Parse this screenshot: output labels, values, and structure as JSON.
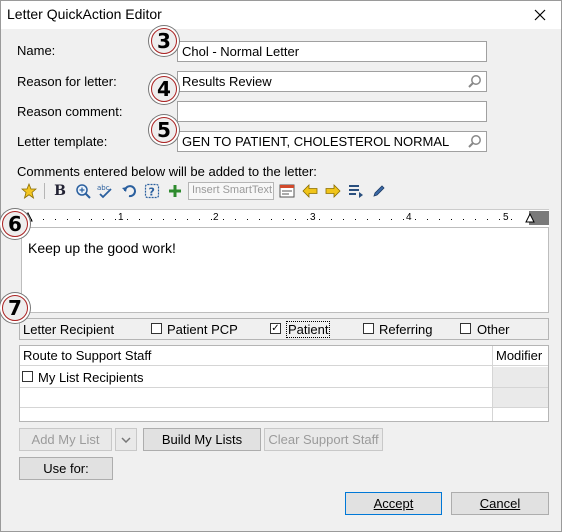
{
  "window": {
    "title": "Letter QuickAction Editor"
  },
  "badges": {
    "b3": "3",
    "b4": "4",
    "b5": "5",
    "b6": "6",
    "b7": "7"
  },
  "form": {
    "name_label": "Name:",
    "name_value": "Chol - Normal Letter",
    "reason_label": "Reason for letter:",
    "reason_value": "Results Review",
    "reason_comment_label": "Reason comment:",
    "reason_comment_value": "",
    "template_label": "Letter template:",
    "template_value": "GEN TO PATIENT, CHOLESTEROL NORMAL"
  },
  "comments": {
    "caption": "Comments entered below will be added to the letter:",
    "smarttext_placeholder": "Insert SmartText",
    "ruler_numbers": [
      "1",
      "2",
      "3",
      "4",
      "5"
    ],
    "body": "Keep up the good work!"
  },
  "toolbar_icons": [
    "star-icon",
    "bold-icon",
    "zoom-icon",
    "spellcheck-icon",
    "undo-icon",
    "help-icon",
    "add-icon",
    "smarttext-list-icon",
    "arrow-left-icon",
    "arrow-right-icon",
    "list-icon",
    "pencil-icon"
  ],
  "recipients": {
    "label": "Letter Recipient",
    "options": [
      {
        "label": "Patient PCP",
        "checked": false
      },
      {
        "label": "Patient",
        "checked": true
      },
      {
        "label": "Referring",
        "checked": false
      },
      {
        "label": "Other",
        "checked": false
      }
    ]
  },
  "support_grid": {
    "columns": [
      "Route to Support Staff",
      "Modifier"
    ],
    "rows": [
      {
        "label": "My List Recipients",
        "checked": false
      }
    ]
  },
  "buttons": {
    "add_my_list": "Add My List",
    "build_my_lists": "Build My Lists",
    "clear_support_staff": "Clear Support Staff",
    "use_for": "Use for:",
    "accept": "Accept",
    "cancel": "Cancel"
  },
  "colors": {
    "badge": "#aa2222",
    "accent": "#0078d7",
    "add_icon": "#2e8b2e"
  }
}
